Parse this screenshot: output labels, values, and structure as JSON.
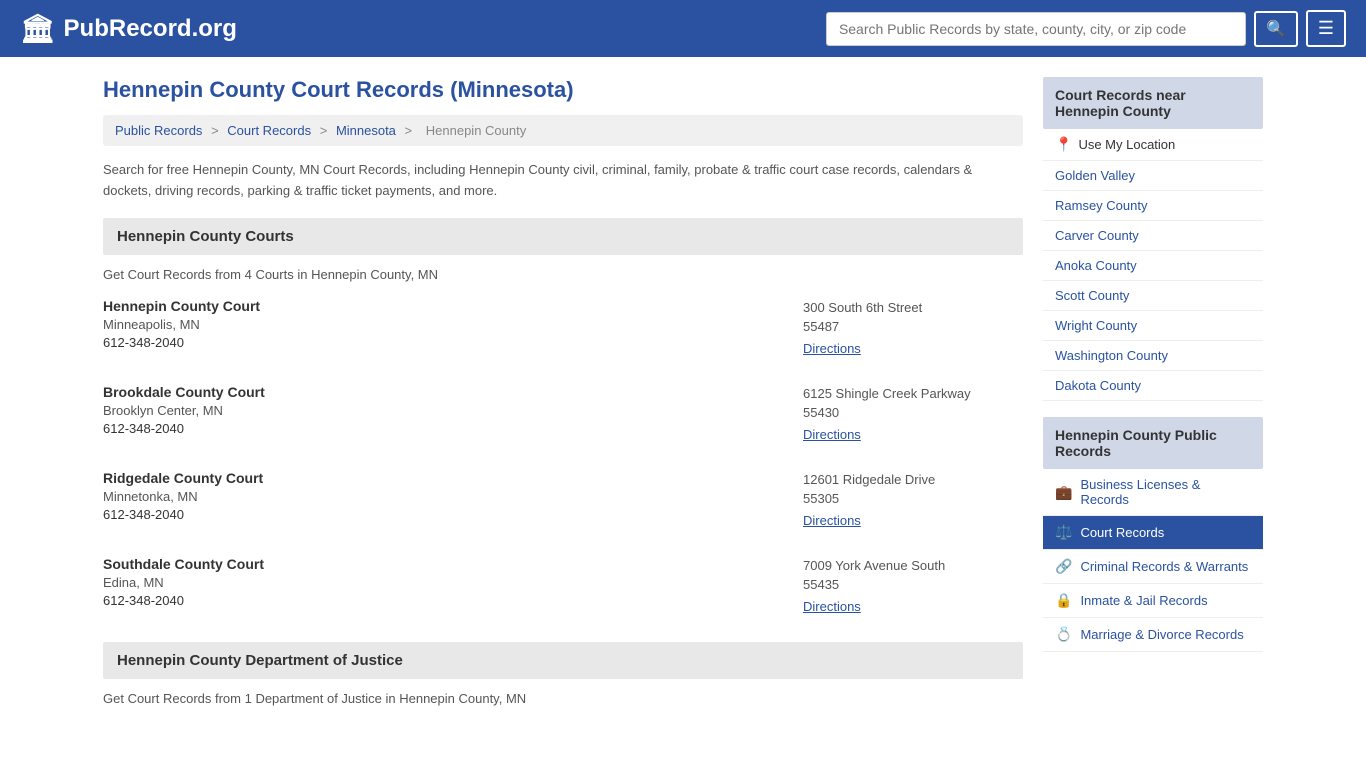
{
  "header": {
    "logo_text": "PubRecord.org",
    "search_placeholder": "Search Public Records by state, county, city, or zip code"
  },
  "page": {
    "title": "Hennepin County Court Records (Minnesota)",
    "description": "Search for free Hennepin County, MN Court Records, including Hennepin County civil, criminal, family, probate & traffic court case records, calendars & dockets, driving records, parking & traffic ticket payments, and more."
  },
  "breadcrumb": {
    "items": [
      "Public Records",
      "Court Records",
      "Minnesota",
      "Hennepin County"
    ]
  },
  "courts_section": {
    "title": "Hennepin County Courts",
    "description": "Get Court Records from 4 Courts in Hennepin County, MN",
    "courts": [
      {
        "name": "Hennepin County Court",
        "city": "Minneapolis, MN",
        "phone": "612-348-2040",
        "address_line1": "300 South 6th Street",
        "address_line2": "55487",
        "directions_label": "Directions"
      },
      {
        "name": "Brookdale County Court",
        "city": "Brooklyn Center, MN",
        "phone": "612-348-2040",
        "address_line1": "6125 Shingle Creek Parkway",
        "address_line2": "55430",
        "directions_label": "Directions"
      },
      {
        "name": "Ridgedale County Court",
        "city": "Minnetonka, MN",
        "phone": "612-348-2040",
        "address_line1": "12601 Ridgedale Drive",
        "address_line2": "55305",
        "directions_label": "Directions"
      },
      {
        "name": "Southdale County Court",
        "city": "Edina, MN",
        "phone": "612-348-2040",
        "address_line1": "7009 York Avenue South",
        "address_line2": "55435",
        "directions_label": "Directions"
      }
    ]
  },
  "dept_section": {
    "title": "Hennepin County Department of Justice",
    "description": "Get Court Records from 1 Department of Justice in Hennepin County, MN"
  },
  "sidebar": {
    "nearby_title": "Court Records near Hennepin County",
    "use_my_location": "Use My Location",
    "nearby_counties": [
      "Golden Valley",
      "Ramsey County",
      "Carver County",
      "Anoka County",
      "Scott County",
      "Wright County",
      "Washington County",
      "Dakota County"
    ],
    "public_records_title": "Hennepin County Public Records",
    "public_records": [
      {
        "label": "Business Licenses & Records",
        "icon": "💼",
        "active": false
      },
      {
        "label": "Court Records",
        "icon": "⚖️",
        "active": true
      },
      {
        "label": "Criminal Records & Warrants",
        "icon": "🔗",
        "active": false
      },
      {
        "label": "Inmate & Jail Records",
        "icon": "🔒",
        "active": false
      },
      {
        "label": "Marriage & Divorce Records",
        "icon": "💍",
        "active": false
      }
    ]
  }
}
